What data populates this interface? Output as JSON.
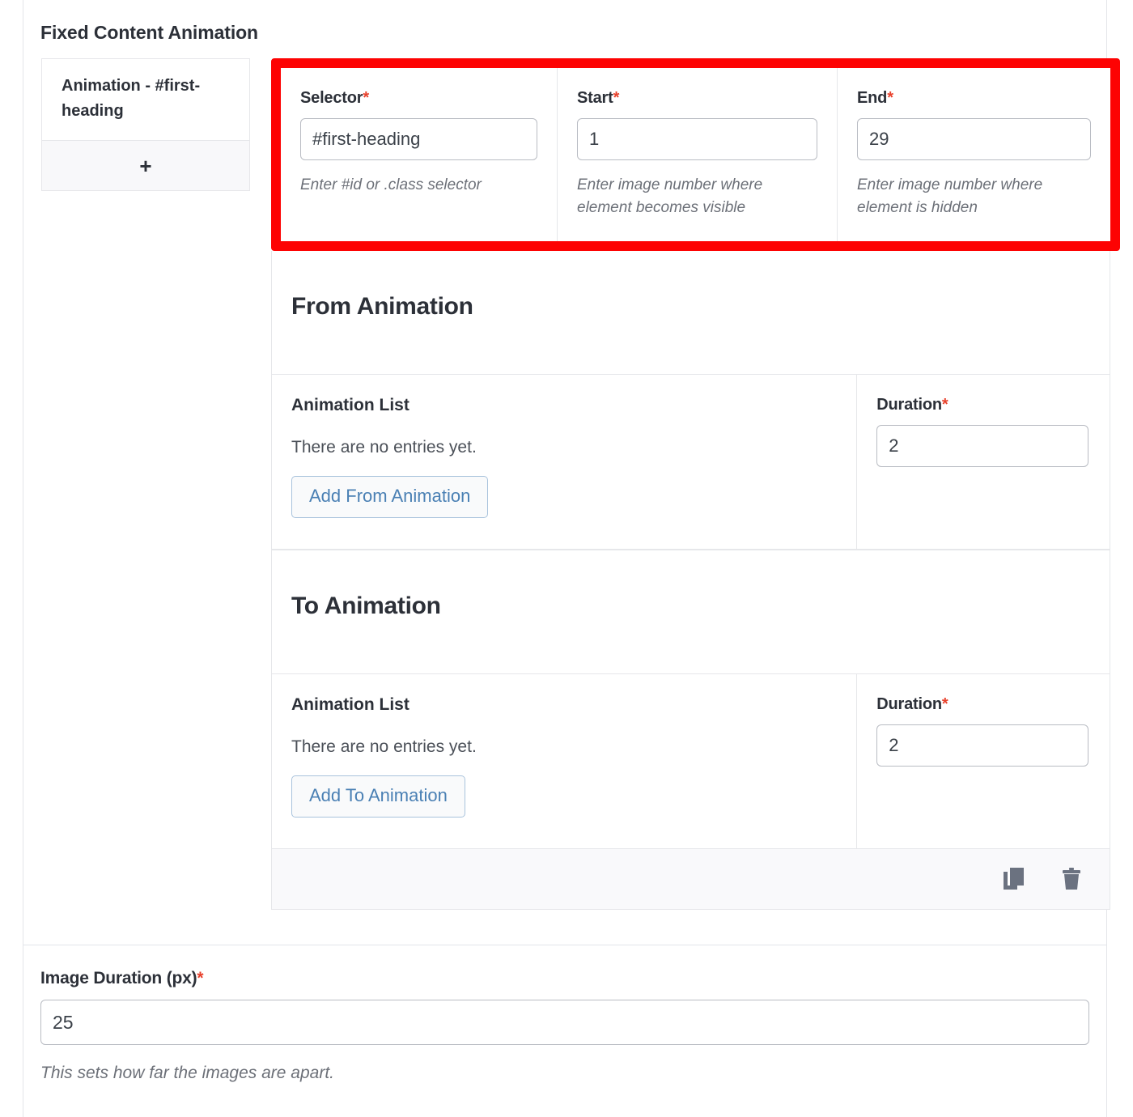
{
  "section": {
    "title": "Fixed Content Animation"
  },
  "tabs": {
    "items": [
      {
        "label": "Animation - #first-heading"
      }
    ],
    "add_label": "+"
  },
  "highlighted_fields": [
    {
      "label": "Selector",
      "required_marker": "*",
      "value": "#first-heading",
      "help": "Enter #id or .class selector"
    },
    {
      "label": "Start",
      "required_marker": "*",
      "value": "1",
      "help": "Enter image number where element becomes visible"
    },
    {
      "label": "End",
      "required_marker": "*",
      "value": "29",
      "help": "Enter image number where element is hidden"
    }
  ],
  "from_animation": {
    "heading": "From Animation",
    "list_label": "Animation List",
    "empty_text": "There are no entries yet.",
    "add_button": "Add From Animation",
    "duration_label": "Duration",
    "duration_required": "*",
    "duration_value": "2"
  },
  "to_animation": {
    "heading": "To Animation",
    "list_label": "Animation List",
    "empty_text": "There are no entries yet.",
    "add_button": "Add To Animation",
    "duration_label": "Duration",
    "duration_required": "*",
    "duration_value": "2"
  },
  "footer_actions": {
    "duplicate_name": "duplicate-icon",
    "delete_name": "trash-icon"
  },
  "image_duration": {
    "label": "Image Duration (px)",
    "required_marker": "*",
    "value": "25",
    "help": "This sets how far the images are apart."
  },
  "colors": {
    "highlight_border": "#fd0303",
    "required_asterisk": "#e8412c",
    "button_text": "#4a80b4",
    "button_border": "#a9c3dc",
    "icon_gray": "#6b7280"
  }
}
